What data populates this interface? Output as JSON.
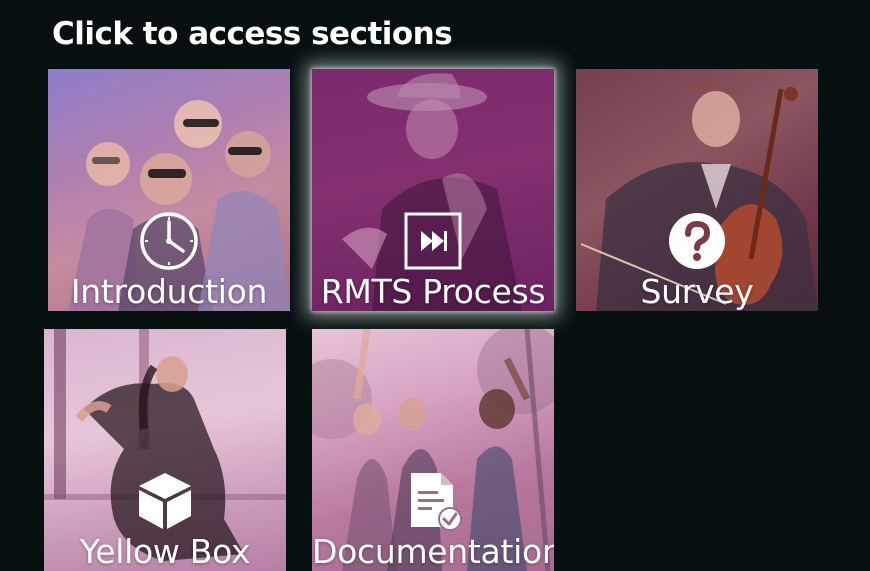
{
  "heading": "Click to access sections",
  "tiles": [
    {
      "label": "Introduction",
      "icon": "clock-icon"
    },
    {
      "label": "RMTS Process",
      "icon": "fast-forward-icon"
    },
    {
      "label": "Survey",
      "icon": "question-icon"
    },
    {
      "label": "Yellow Box",
      "icon": "box-icon"
    },
    {
      "label": "Documentation",
      "icon": "document-check-icon"
    }
  ],
  "colors": {
    "background": "#061010",
    "highlight_glow": "#e6f0eb",
    "label": "#ffffff"
  }
}
